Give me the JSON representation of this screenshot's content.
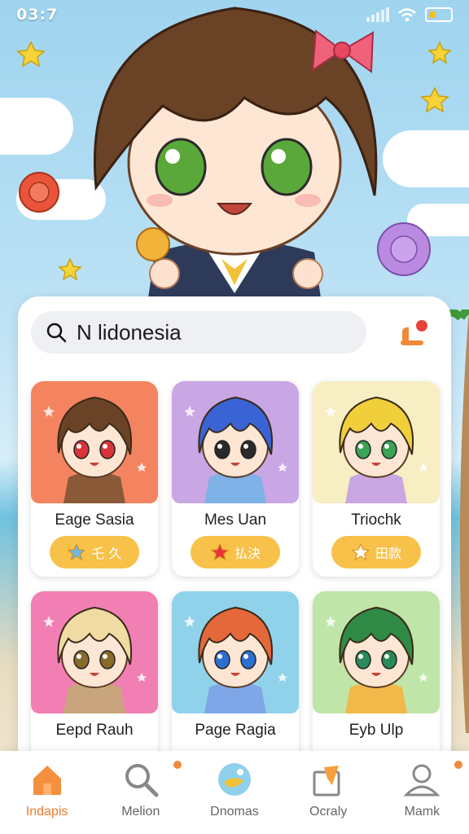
{
  "status_bar": {
    "time": "03:7"
  },
  "search": {
    "value": "N lidonesia"
  },
  "cards": [
    {
      "name": "Eage Sasia",
      "badge": "乇 久",
      "bg": "#f4845f",
      "hair": "#6a4326",
      "eyes": "#d9343a",
      "shirt": "#8a5a38",
      "star": "#6fb6e8"
    },
    {
      "name": "Mes Uan",
      "badge": "払決",
      "bg": "#c9a6e4",
      "hair": "#3a63d6",
      "eyes": "#2a2a2a",
      "shirt": "#7fb2e6",
      "star": "#e8323a"
    },
    {
      "name": "Triochk",
      "badge": "田款",
      "bg": "#f7eec3",
      "hair": "#f1cf3b",
      "eyes": "#3aa355",
      "shirt": "#c9a7e0",
      "star": "#ffffff"
    },
    {
      "name": "Eepd Rauh",
      "badge": "",
      "bg": "#f27fb3",
      "hair": "#f0dca3",
      "eyes": "#8a6a2a",
      "shirt": "#c8a57d",
      "star": "#ffffff"
    },
    {
      "name": "Page Ragia",
      "badge": "",
      "bg": "#8fd2ea",
      "hair": "#e5683a",
      "eyes": "#2d6fd1",
      "shirt": "#7fa7e8",
      "star": "#ffffff"
    },
    {
      "name": "Eyb Ulp",
      "badge": "",
      "bg": "#bfe6a8",
      "hair": "#2e8a45",
      "eyes": "#2a8a5a",
      "shirt": "#f2b94a",
      "star": "#ffffff"
    }
  ],
  "nav": [
    {
      "label": "Indapis",
      "icon": "home-icon",
      "active": true
    },
    {
      "label": "Melion",
      "icon": "search-icon",
      "active": false
    },
    {
      "label": "Dnomas",
      "icon": "globe-icon",
      "active": false
    },
    {
      "label": "Ocraly",
      "icon": "bookmark-icon",
      "active": false
    },
    {
      "label": "Mamk",
      "icon": "profile-icon",
      "active": false
    }
  ],
  "colors": {
    "accent": "#f07a2b",
    "badge": "#f7c14a",
    "panel": "#ffffff"
  }
}
